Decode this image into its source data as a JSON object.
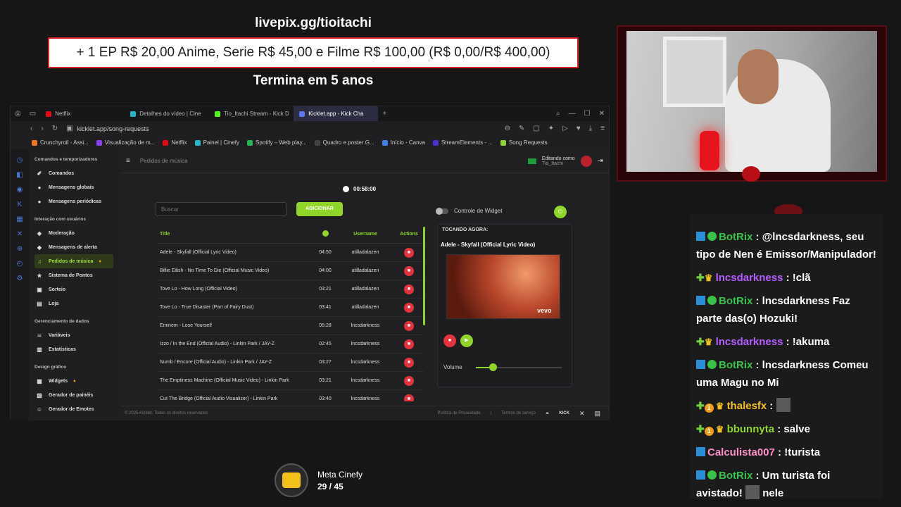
{
  "overlay": {
    "livepix": "livepix.gg/tioitachi",
    "goal_text": "+ 1 EP R$ 20,00 Anime, Serie R$ 45,00 e Filme R$ 100,00 (R$ 0,00/R$ 400,00)",
    "ends": "Termina em 5 anos"
  },
  "browser": {
    "tabs": [
      {
        "label": "Netflix",
        "color": "#e50914"
      },
      {
        "label": "Detalhes do vídeo | Cine",
        "color": "#22b8c9"
      },
      {
        "label": "Tio_Itachi Stream - Kick D",
        "color": "#53fc18"
      },
      {
        "label": "Kicklet.app - Kick Cha",
        "color": "#5a78f0"
      }
    ],
    "url": "kicklet.app/song-requests",
    "bookmarks": [
      {
        "label": "Crunchyroll - Assi...",
        "color": "#f47521"
      },
      {
        "label": "Visualização de m...",
        "color": "#8a3ffc"
      },
      {
        "label": "Netflix",
        "color": "#e50914"
      },
      {
        "label": "Painel | Cinefy",
        "color": "#22b8c9"
      },
      {
        "label": "Spotify – Web play...",
        "color": "#1db954"
      },
      {
        "label": "Quadro e poster G...",
        "color": "#444444"
      },
      {
        "label": "Início - Canva",
        "color": "#3d7ff0"
      },
      {
        "label": "StreamElements - ...",
        "color": "#4b2fd6"
      },
      {
        "label": "Song Requests",
        "color": "#8fd52a"
      }
    ]
  },
  "sidebar": {
    "sections": [
      {
        "title": "Comandos e temporizadores",
        "items": [
          {
            "label": "Comandos",
            "icon": "wand-icon"
          },
          {
            "label": "Mensagens globais",
            "icon": "chat-icon"
          },
          {
            "label": "Mensagens periódicas",
            "icon": "chat-icon"
          }
        ]
      },
      {
        "title": "Interação com usuários",
        "items": [
          {
            "label": "Moderação",
            "icon": "shield-icon"
          },
          {
            "label": "Mensagens de alerta",
            "icon": "bell-icon"
          },
          {
            "label": "Pedidos de música",
            "icon": "music-icon",
            "active": true
          },
          {
            "label": "Sistema de Pontos",
            "icon": "star-icon"
          },
          {
            "label": "Sorteio",
            "icon": "gift-icon"
          },
          {
            "label": "Loja",
            "icon": "cart-icon"
          }
        ]
      },
      {
        "title": "Gerenciamento de dados",
        "items": [
          {
            "label": "Variáveis",
            "icon": "link-icon"
          },
          {
            "label": "Estatísticas",
            "icon": "chart-icon"
          }
        ]
      },
      {
        "title": "Design gráfico",
        "items": [
          {
            "label": "Widgets",
            "icon": "grid-icon"
          },
          {
            "label": "Gerador de painéis",
            "icon": "panel-icon"
          },
          {
            "label": "Gerador de Emotes",
            "icon": "emote-icon"
          }
        ]
      }
    ]
  },
  "main": {
    "header": "Pedidos de música",
    "editing_as": "Editando como",
    "user": "Tio_Itachi",
    "timer": "00:58:00",
    "search_placeholder": "Buscar",
    "add_label": "ADICIONAR",
    "widget_control": "Controle de Widget",
    "columns": {
      "title": "Title",
      "username": "Username",
      "actions": "Actions"
    },
    "songs": [
      {
        "title": "Adele - Skyfall (Official Lyric Video)",
        "duration": "04:50",
        "user": "atilladalazen"
      },
      {
        "title": "Billie Eilish - No Time To Die (Official Music Video)",
        "duration": "04:00",
        "user": "atilladalazen"
      },
      {
        "title": "Tove Lo - How Long (Official Video)",
        "duration": "03:21",
        "user": "atilladalazen"
      },
      {
        "title": "Tove Lo - True Disaster (Part of Fairy Dust)",
        "duration": "03:41",
        "user": "atilladalazen"
      },
      {
        "title": "Eminem - Lose Yourself",
        "duration": "05:28",
        "user": "lncsdarkness"
      },
      {
        "title": "Izzo / In the End (Official Audio) - Linkin Park / JAY-Z",
        "duration": "02:45",
        "user": "lncsdarkness"
      },
      {
        "title": "Numb / Encore (Official Audio) - Linkin Park / JAY-Z",
        "duration": "03:27",
        "user": "lncsdarkness"
      },
      {
        "title": "The Emptiness Machine (Official Music Video) - Linkin Park",
        "duration": "03:21",
        "user": "lncsdarkness"
      },
      {
        "title": "Cut The Bridge (Official Audio Visualizer) - Linkin Park",
        "duration": "03:40",
        "user": "lncsdarkness"
      }
    ],
    "now_playing_label": "TOCANDO AGORA:",
    "now_playing_title": "Adele - Skyfall (Official Lyric Video)",
    "vevo": "vevo",
    "volume_label": "Volume",
    "volume_level": 0.2,
    "footer_copyright": "© 2025 Kicklet. Todos os direitos reservados",
    "footer_privacy": "Política de Privacidade",
    "footer_terms": "Termos de serviço"
  },
  "chat": [
    {
      "badges": [
        "bot"
      ],
      "user": "BotRix",
      "user_color": "#3ac14a",
      "text": " : @lncsdarkness, seu tipo de Nen é Emissor/Manipulador!"
    },
    {
      "badges": [
        "plus",
        "crown"
      ],
      "user": "lncsdarkness",
      "user_color": "#b45cff",
      "text": " : !clã"
    },
    {
      "badges": [
        "bot"
      ],
      "user": "BotRix",
      "user_color": "#3ac14a",
      "text": " : lncsdarkness Faz parte das(o) Hozuki!"
    },
    {
      "badges": [
        "plus",
        "crown"
      ],
      "user": "lncsdarkness",
      "user_color": "#b45cff",
      "text": " : !akuma"
    },
    {
      "badges": [
        "bot"
      ],
      "user": "BotRix",
      "user_color": "#3ac14a",
      "text": " : lncsdarkness Comeu uma Magu no Mi"
    },
    {
      "badges": [
        "plus",
        "one",
        "crown"
      ],
      "user": "thalesfx",
      "user_color": "#f2c21a",
      "text": " : ",
      "emote": true
    },
    {
      "badges": [
        "plus",
        "one",
        "crown"
      ],
      "user": "bbunnyta",
      "user_color": "#8fd52a",
      "text": " : salve"
    },
    {
      "badges": [
        "sq"
      ],
      "user": "Calculista007",
      "user_color": "#ff8fc8",
      "text": " : !turista"
    },
    {
      "badges": [
        "bot"
      ],
      "user": "BotRix",
      "user_color": "#3ac14a",
      "text": " : Um turista foi avistado! ",
      "emote": true,
      "after": " nele"
    }
  ],
  "meta": {
    "title": "Meta Cinefy",
    "count": "29 / 45"
  }
}
